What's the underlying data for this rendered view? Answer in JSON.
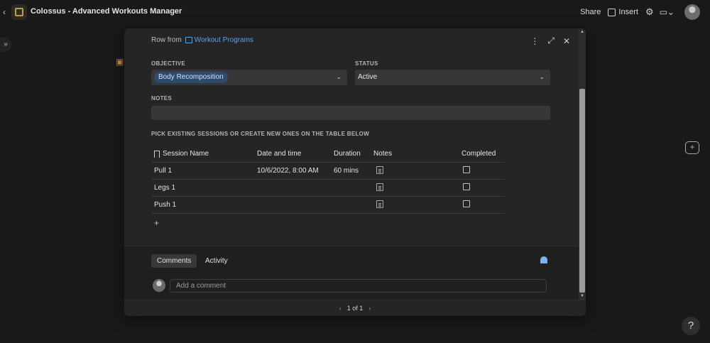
{
  "topbar": {
    "back_icon": "‹",
    "title": "Colossus - Advanced Workouts Manager",
    "share_label": "Share",
    "insert_label": "Insert",
    "gear_icon": "⚙",
    "doc_icon": "▭⌄"
  },
  "modal": {
    "row_from_prefix": "Row from",
    "table_name": "Workout Programs",
    "more_icon": "⋮",
    "expand_icon": "⤢",
    "close_icon": "✕",
    "objective": {
      "label": "OBJECTIVE",
      "value": "Body Recomposition"
    },
    "status": {
      "label": "STATUS",
      "value": "Active"
    },
    "notes": {
      "label": "NOTES",
      "value": ""
    },
    "sessions_label": "PICK EXISTING SESSIONS OR CREATE NEW ONES ON THE TABLE BELOW",
    "table": {
      "headers": [
        "Session Name",
        "Date and time",
        "Duration",
        "Notes",
        "Completed"
      ],
      "rows": [
        {
          "name": "Pull 1",
          "datetime": "10/6/2022, 8:00 AM",
          "duration": "60 mins"
        },
        {
          "name": "Legs 1",
          "datetime": "",
          "duration": ""
        },
        {
          "name": "Push 1",
          "datetime": "",
          "duration": ""
        }
      ],
      "add_row": "+"
    },
    "tabs": {
      "comments": "Comments",
      "activity": "Activity"
    },
    "comment_placeholder": "Add a comment",
    "pager": {
      "prev": "‹",
      "text": "1 of 1",
      "next": "›"
    }
  },
  "help_label": "?",
  "colors": {
    "accent": "#5aa3ea",
    "tag_bg": "#2e4a6e",
    "modal_bg": "#252525",
    "page_bg": "#191919"
  }
}
